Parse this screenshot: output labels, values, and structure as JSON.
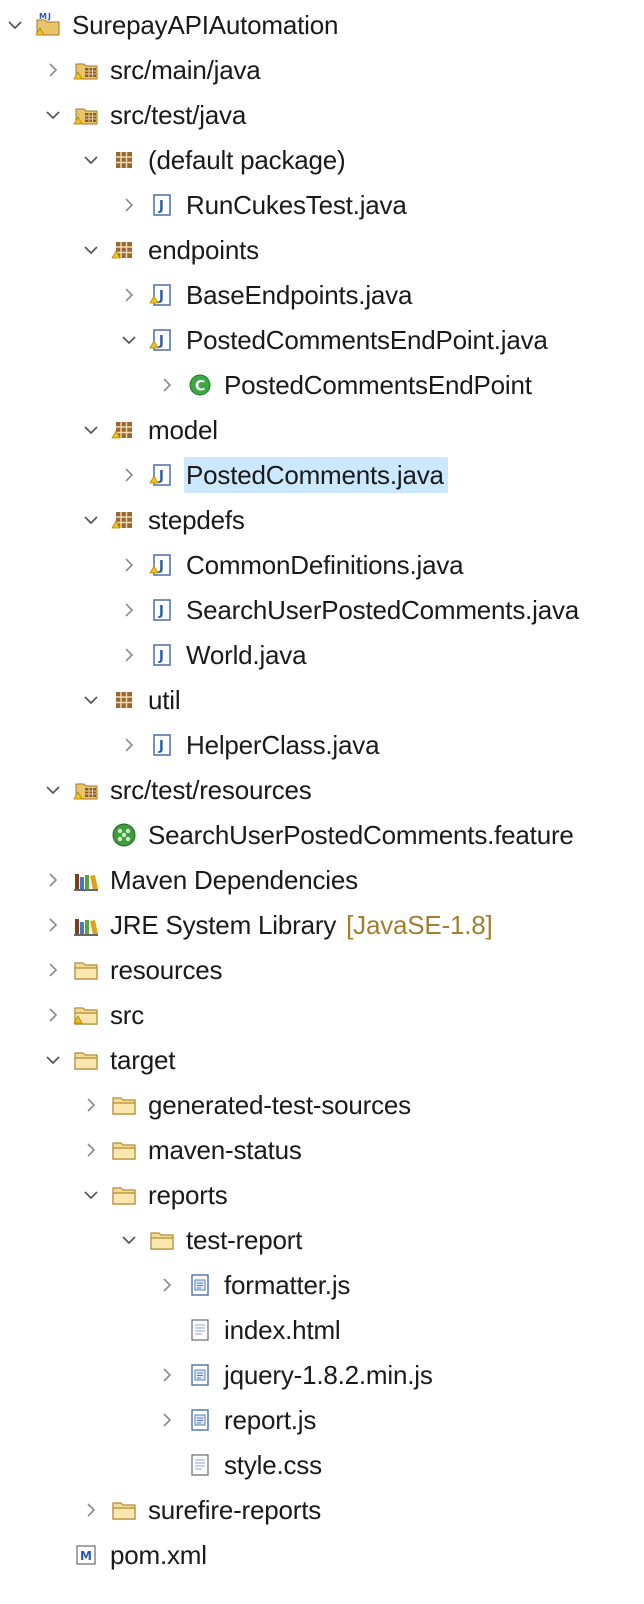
{
  "tree": [
    {
      "id": "proj",
      "label": "SurepayAPIAutomation",
      "level": 0,
      "state": "expanded",
      "icon": "maven-project-icon"
    },
    {
      "id": "src-main-java",
      "label": "src/main/java",
      "level": 1,
      "state": "collapsed",
      "icon": "source-folder-icon"
    },
    {
      "id": "src-test-java",
      "label": "src/test/java",
      "level": 1,
      "state": "expanded",
      "icon": "source-folder-icon"
    },
    {
      "id": "pkg-default",
      "label": "(default package)",
      "level": 2,
      "state": "expanded",
      "icon": "package-icon"
    },
    {
      "id": "runcukes",
      "label": "RunCukesTest.java",
      "level": 3,
      "state": "collapsed",
      "icon": "java-file-icon"
    },
    {
      "id": "pkg-endpoints",
      "label": "endpoints",
      "level": 2,
      "state": "expanded",
      "icon": "package-warning-icon"
    },
    {
      "id": "baseendpoints",
      "label": "BaseEndpoints.java",
      "level": 3,
      "state": "collapsed",
      "icon": "java-file-warning-icon"
    },
    {
      "id": "postedcommentsep-java",
      "label": "PostedCommentsEndPoint.java",
      "level": 3,
      "state": "expanded",
      "icon": "java-file-warning-icon"
    },
    {
      "id": "postedcommentsep-class",
      "label": "PostedCommentsEndPoint",
      "level": 4,
      "state": "collapsed",
      "icon": "class-icon"
    },
    {
      "id": "pkg-model",
      "label": "model",
      "level": 2,
      "state": "expanded",
      "icon": "package-warning-icon"
    },
    {
      "id": "postedcomments-java",
      "label": "PostedComments.java",
      "level": 3,
      "state": "collapsed",
      "icon": "java-file-warning-icon",
      "selected": true
    },
    {
      "id": "pkg-stepdefs",
      "label": "stepdefs",
      "level": 2,
      "state": "expanded",
      "icon": "package-warning-icon"
    },
    {
      "id": "commondefs",
      "label": "CommonDefinitions.java",
      "level": 3,
      "state": "collapsed",
      "icon": "java-file-warning-icon"
    },
    {
      "id": "searchuser-java",
      "label": "SearchUserPostedComments.java",
      "level": 3,
      "state": "collapsed",
      "icon": "java-file-icon"
    },
    {
      "id": "world",
      "label": "World.java",
      "level": 3,
      "state": "collapsed",
      "icon": "java-file-icon"
    },
    {
      "id": "pkg-util",
      "label": "util",
      "level": 2,
      "state": "expanded",
      "icon": "package-icon"
    },
    {
      "id": "helperclass",
      "label": "HelperClass.java",
      "level": 3,
      "state": "collapsed",
      "icon": "java-file-icon"
    },
    {
      "id": "src-test-resources",
      "label": "src/test/resources",
      "level": 1,
      "state": "expanded",
      "icon": "source-folder-icon"
    },
    {
      "id": "feature",
      "label": "SearchUserPostedComments.feature",
      "level": 2,
      "state": "leaf",
      "icon": "cucumber-feature-icon"
    },
    {
      "id": "maven-deps",
      "label": "Maven Dependencies",
      "level": 1,
      "state": "collapsed",
      "icon": "library-icon"
    },
    {
      "id": "jre",
      "label": "JRE System Library",
      "decoration": "[JavaSE-1.8]",
      "level": 1,
      "state": "collapsed",
      "icon": "library-icon"
    },
    {
      "id": "resources",
      "label": "resources",
      "level": 1,
      "state": "collapsed",
      "icon": "folder-icon"
    },
    {
      "id": "src",
      "label": "src",
      "level": 1,
      "state": "collapsed",
      "icon": "folder-warning-icon"
    },
    {
      "id": "target",
      "label": "target",
      "level": 1,
      "state": "expanded",
      "icon": "folder-icon"
    },
    {
      "id": "gen-test-sources",
      "label": "generated-test-sources",
      "level": 2,
      "state": "collapsed",
      "icon": "folder-icon"
    },
    {
      "id": "maven-status",
      "label": "maven-status",
      "level": 2,
      "state": "collapsed",
      "icon": "folder-icon"
    },
    {
      "id": "reports",
      "label": "reports",
      "level": 2,
      "state": "expanded",
      "icon": "folder-icon"
    },
    {
      "id": "test-report",
      "label": "test-report",
      "level": 3,
      "state": "expanded",
      "icon": "folder-icon"
    },
    {
      "id": "formatter",
      "label": "formatter.js",
      "level": 4,
      "state": "collapsed",
      "icon": "js-file-icon"
    },
    {
      "id": "indexhtml",
      "label": "index.html",
      "level": 4,
      "state": "leaf",
      "icon": "text-file-icon"
    },
    {
      "id": "jquery",
      "label": "jquery-1.8.2.min.js",
      "level": 4,
      "state": "collapsed",
      "icon": "js-file-icon"
    },
    {
      "id": "reportjs",
      "label": "report.js",
      "level": 4,
      "state": "collapsed",
      "icon": "js-file-icon"
    },
    {
      "id": "stylecss",
      "label": "style.css",
      "level": 4,
      "state": "leaf",
      "icon": "text-file-icon"
    },
    {
      "id": "surefire",
      "label": "surefire-reports",
      "level": 2,
      "state": "collapsed",
      "icon": "folder-icon"
    },
    {
      "id": "pom",
      "label": "pom.xml",
      "level": 1,
      "state": "leaf",
      "icon": "maven-pom-icon"
    }
  ],
  "colors": {
    "selection": "#cce8ff",
    "chevron": "#6e6e6e",
    "decoration": "#a08030",
    "folder": "#d8a64a",
    "package": "#8a5a2a",
    "warning": "#e8b300"
  }
}
